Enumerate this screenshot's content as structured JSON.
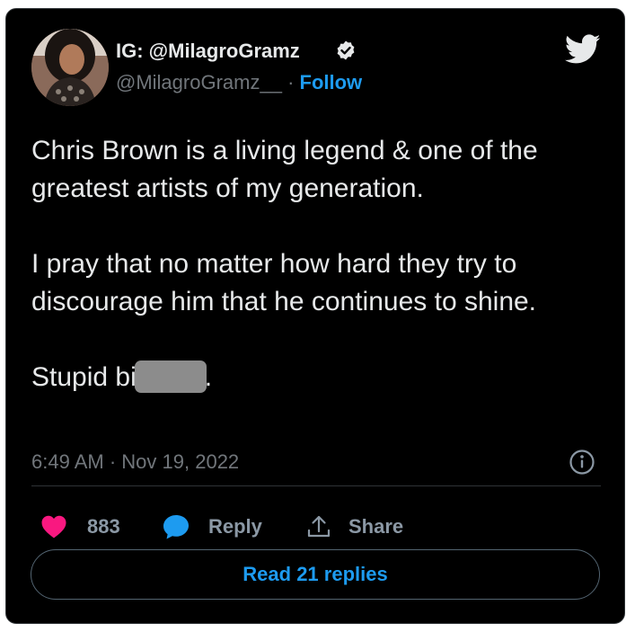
{
  "author": {
    "display_name": "IG: @MilagroGramz",
    "handle": "@MilagroGramz__",
    "separator": "·",
    "follow_label": "Follow",
    "verified": true
  },
  "tweet": {
    "paragraphs": [
      "Chris Brown is a living legend & one of the greatest artists of my generation.",
      "I pray that no matter how hard they try to discourage him that he continues to shine."
    ],
    "final_line_prefix": "Stupid bi",
    "final_line_suffix": "."
  },
  "timestamp": {
    "time": "6:49 AM",
    "separator": "·",
    "date": "Nov 19, 2022"
  },
  "actions": {
    "like_count": "883",
    "reply_label": "Reply",
    "share_label": "Share"
  },
  "read_replies_label": "Read 21 replies",
  "colors": {
    "background": "#000000",
    "text": "#e7e9ea",
    "secondary": "#71767b",
    "link": "#1d9bf0",
    "like": "#f91880"
  },
  "icons": {
    "brand": "twitter-bird-icon",
    "verified": "verified-badge-icon",
    "info": "info-icon",
    "like": "heart-icon",
    "reply": "speech-bubble-icon",
    "share": "share-arrow-icon"
  }
}
